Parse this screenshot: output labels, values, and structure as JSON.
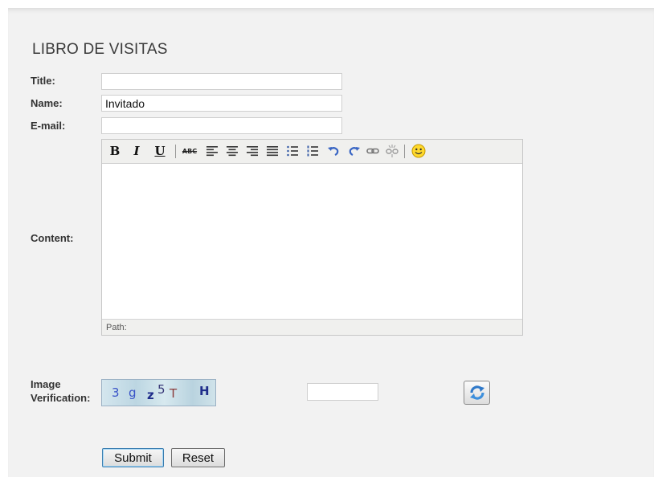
{
  "page_title": "LIBRO DE VISITAS",
  "form": {
    "title_label": "Title:",
    "title_value": "",
    "name_label": "Name:",
    "name_value": "Invitado",
    "email_label": "E-mail:",
    "email_value": "",
    "content_label": "Content:",
    "captcha_label_line1": "Image",
    "captcha_label_line2": "Verification:",
    "captcha_text": [
      "3",
      "g",
      "z",
      "5",
      "T",
      "H"
    ],
    "captcha_input_value": ""
  },
  "editor": {
    "toolbar": {
      "bold": "B",
      "italic": "I",
      "underline": "U",
      "spellcheck": "ABC",
      "icons": [
        "bold-icon",
        "italic-icon",
        "underline-icon",
        "strikethrough-icon",
        "align-left-icon",
        "align-center-icon",
        "align-right-icon",
        "align-justify-icon",
        "bullet-list-icon",
        "numbered-list-icon",
        "undo-icon",
        "redo-icon",
        "link-icon",
        "unlink-icon",
        "emoticon-icon"
      ]
    },
    "status_path": "Path:"
  },
  "buttons": {
    "submit": "Submit",
    "reset": "Reset",
    "refresh_icon": "refresh-icon"
  },
  "colors": {
    "panel_bg": "#f2f2f2",
    "accent_blue": "#3c7fb1",
    "captcha_text": "#2b3aa8"
  }
}
